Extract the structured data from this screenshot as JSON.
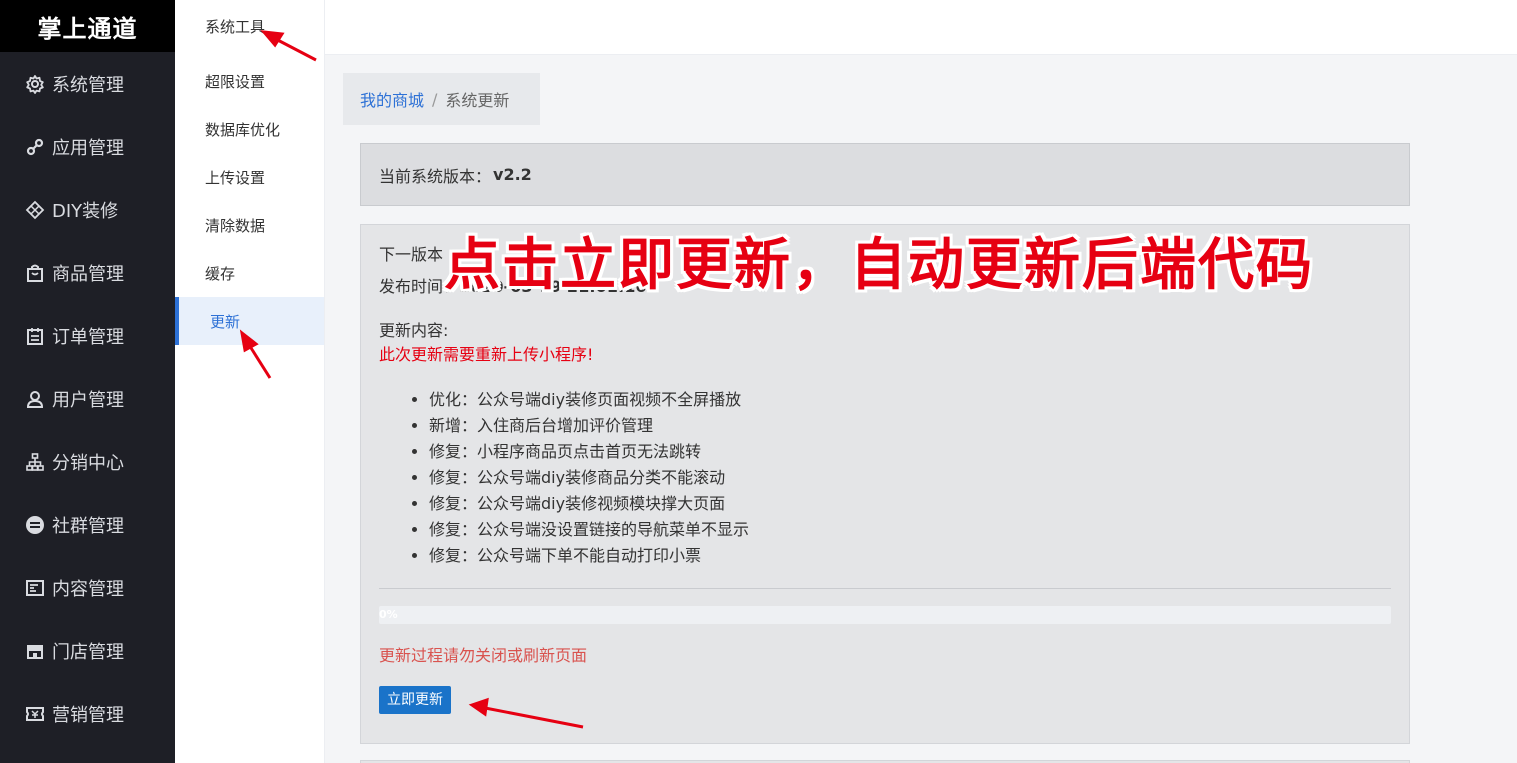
{
  "logo": "掌上通道",
  "sidebar": {
    "items": [
      {
        "label": "系统管理",
        "icon": "gear-icon"
      },
      {
        "label": "应用管理",
        "icon": "link-icon"
      },
      {
        "label": "DIY装修",
        "icon": "diamond-icon"
      },
      {
        "label": "商品管理",
        "icon": "shopping-bag-icon"
      },
      {
        "label": "订单管理",
        "icon": "calendar-icon"
      },
      {
        "label": "用户管理",
        "icon": "user-icon"
      },
      {
        "label": "分销中心",
        "icon": "hierarchy-icon"
      },
      {
        "label": "社群管理",
        "icon": "circle-minus-icon"
      },
      {
        "label": "内容管理",
        "icon": "document-icon"
      },
      {
        "label": "门店管理",
        "icon": "store-icon"
      },
      {
        "label": "营销管理",
        "icon": "ticket-icon"
      }
    ]
  },
  "submenu": {
    "title": "系统工具",
    "items": [
      {
        "label": "超限设置"
      },
      {
        "label": "数据库优化"
      },
      {
        "label": "上传设置"
      },
      {
        "label": "清除数据"
      },
      {
        "label": "缓存"
      },
      {
        "label": "更新",
        "active": true
      }
    ]
  },
  "breadcrumb": {
    "link": "我的商城",
    "separator": "/",
    "current": "系统更新"
  },
  "version": {
    "label": "当前系统版本：",
    "value": "v2.2"
  },
  "update": {
    "next_label": "下一版本",
    "release_label": "发布时间：",
    "release_time": "2020-03-19 21:01:16",
    "content_label": "更新内容:",
    "notice": "此次更新需要重新上传小程序!",
    "changes": [
      "优化：公众号端diy装修页面视频不全屏播放",
      "新增：入住商后台增加评价管理",
      "修复：小程序商品页点击首页无法跳转",
      "修复：公众号端diy装修商品分类不能滚动",
      "修复：公众号端diy装修视频模块撑大页面",
      "修复：公众号端没设置链接的导航菜单不显示",
      "修复：公众号端下单不能自动打印小票"
    ],
    "progress_text": "0%",
    "progress_value": 0,
    "warning": "更新过程请勿关闭或刷新页面",
    "button": "立即更新"
  },
  "annotation": {
    "text": "点击立即更新，自动更新后端代码",
    "color": "#e60012"
  },
  "colors": {
    "accent": "#2d71d6",
    "sidebar_bg": "#1e1f26",
    "warning": "#d9534f"
  }
}
